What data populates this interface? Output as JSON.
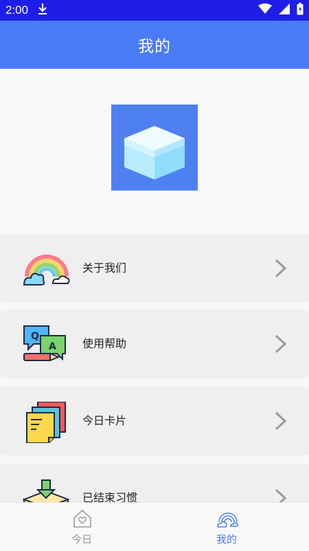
{
  "status_bar": {
    "time": "2:00",
    "icons": [
      "download-icon",
      "wifi-icon",
      "signal-icon",
      "battery-icon"
    ]
  },
  "header": {
    "title": "我的"
  },
  "logo": {
    "icon": "box-icon"
  },
  "menu": {
    "items": [
      {
        "label": "关于我们",
        "icon": "rainbow-icon"
      },
      {
        "label": "使用帮助",
        "icon": "qa-chat-icon"
      },
      {
        "label": "今日卡片",
        "icon": "sticky-notes-icon"
      },
      {
        "label": "已结束习惯",
        "icon": "archive-box-icon"
      }
    ]
  },
  "tabbar": {
    "tabs": [
      {
        "label": "今日",
        "icon": "home-heart-icon",
        "active": false
      },
      {
        "label": "我的",
        "icon": "rainbow-outline-icon",
        "active": true
      }
    ],
    "active_color": "#4a7cf7",
    "inactive_color": "#9a9a9a"
  },
  "colors": {
    "status_bar": "#1e1ee8",
    "app_bar": "#4a7cf7",
    "logo_bg": "#4f80f2",
    "menu_bg": "#efefef"
  }
}
